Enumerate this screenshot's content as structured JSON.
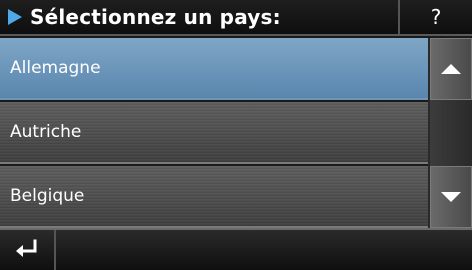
{
  "header": {
    "title": "Sélectionnez un pays:",
    "title_icon": "play-icon",
    "help_label": "?"
  },
  "list": {
    "items": [
      {
        "label": "Allemagne",
        "selected": true
      },
      {
        "label": "Autriche",
        "selected": false
      },
      {
        "label": "Belgique",
        "selected": false
      }
    ]
  },
  "scrollbar": {
    "up_icon": "arrow-up-icon",
    "down_icon": "arrow-down-icon"
  },
  "footer": {
    "back_icon": "return-arrow-icon"
  },
  "colors": {
    "accent": "#4fa8e8",
    "selected_row": "#6a94ba"
  }
}
